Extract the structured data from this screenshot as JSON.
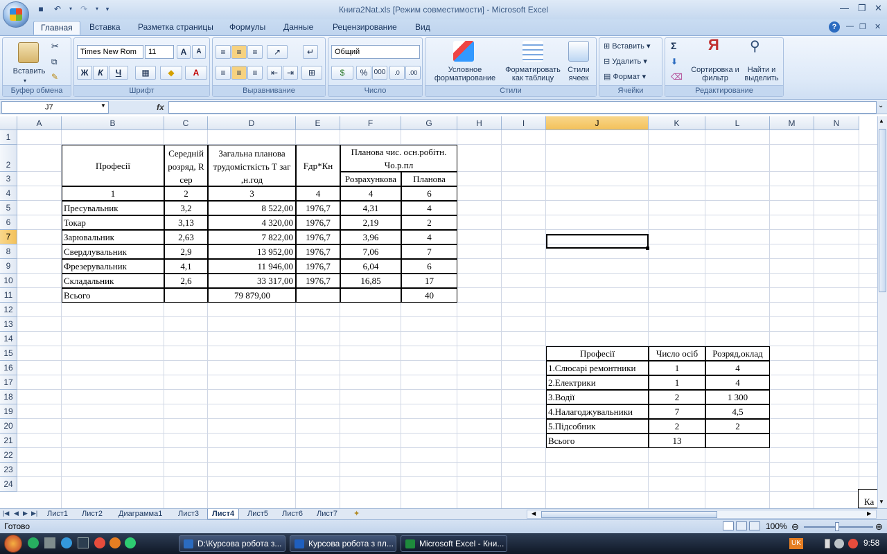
{
  "window": {
    "title": "Книга2Nat.xls  [Режим совместимости] - Microsoft Excel"
  },
  "ribbon_tabs": [
    "Главная",
    "Вставка",
    "Разметка страницы",
    "Формулы",
    "Данные",
    "Рецензирование",
    "Вид"
  ],
  "ribbon": {
    "groups": {
      "clipboard": "Буфер обмена",
      "font": "Шрифт",
      "alignment": "Выравнивание",
      "number": "Число",
      "styles": "Стили",
      "cells": "Ячейки",
      "editing": "Редактирование"
    },
    "paste": "Вставить",
    "font_name": "Times New Rom",
    "font_size": "11",
    "bold": "Ж",
    "italic": "К",
    "underline": "Ч",
    "number_format": "Общий",
    "percent": "%",
    "thousands": "000",
    "cond_format": "Условное форматирование",
    "format_table": "Форматировать как таблицу",
    "cell_styles": "Стили ячеек",
    "insert": "Вставить",
    "delete": "Удалить",
    "format": "Формат",
    "sum": "Σ",
    "sort": "Сортировка и фильтр",
    "find": "Найти и выделить"
  },
  "formula_bar": {
    "name_box": "J7",
    "fx": "fx",
    "formula": ""
  },
  "columns": [
    "A",
    "B",
    "C",
    "D",
    "E",
    "F",
    "G",
    "H",
    "I",
    "J",
    "K",
    "L",
    "M",
    "N"
  ],
  "rows": [
    "1",
    "2",
    "3",
    "4",
    "5",
    "6",
    "7",
    "8",
    "9",
    "10",
    "11",
    "12",
    "13",
    "14",
    "15",
    "16",
    "17",
    "18",
    "19",
    "20",
    "21",
    "22",
    "23",
    "24"
  ],
  "table1": {
    "h_prof": "Професії",
    "h_rank": "Середній розряд, R сер",
    "h_labor": "Загальна планова трудомісткість Т заг ,н.год",
    "h_fd": "Fдр*Кн",
    "h_plan_group": "Планова чис. осн.робітн. Чо.р.пл",
    "h_calc": "Розрахункова",
    "h_plan": "Планова",
    "nums": [
      "1",
      "2",
      "3",
      "4",
      "4",
      "6"
    ],
    "rows": [
      [
        "Пресувальник",
        "3,2",
        "8 522,00",
        "1976,7",
        "4,31",
        "4"
      ],
      [
        "Токар",
        "3,13",
        "4 320,00",
        "1976,7",
        "2,19",
        "2"
      ],
      [
        "Зарювальник",
        "2,63",
        "7 822,00",
        "1976,7",
        "3,96",
        "4"
      ],
      [
        "Свердлувальник",
        "2,9",
        "13 952,00",
        "1976,7",
        "7,06",
        "7"
      ],
      [
        "Фрезерувальник",
        "4,1",
        "11 946,00",
        "1976,7",
        "6,04",
        "6"
      ],
      [
        "Складальник",
        "2,6",
        "33 317,00",
        "1976,7",
        "16,85",
        "17"
      ]
    ],
    "total": [
      "Всього",
      "",
      "79 879,00",
      "",
      "",
      "40"
    ]
  },
  "table2": {
    "headers": [
      "Професії",
      "Число осіб",
      "Розряд,оклад"
    ],
    "rows": [
      [
        "1.Слюсарі ремонтники",
        "1",
        "4"
      ],
      [
        "2.Електрики",
        "1",
        "4"
      ],
      [
        "3.Водії",
        "2",
        "1 300"
      ],
      [
        "4.Налагоджувальники",
        "7",
        "4,5"
      ],
      [
        "5.Підсобник",
        "2",
        "2"
      ],
      [
        "Всього",
        "13",
        ""
      ]
    ]
  },
  "partial_cell": "Ка",
  "sheet_tabs": [
    "Лист1",
    "Лист2",
    "Диаграмма1",
    "Лист3",
    "Лист4",
    "Лист5",
    "Лист6",
    "Лист7"
  ],
  "active_sheet": "Лист4",
  "status": {
    "ready": "Готово",
    "zoom": "100%"
  },
  "taskbar": {
    "items": [
      "D:\\Курсова робота з...",
      "Курсова робота з пл...",
      "Microsoft Excel - Кни..."
    ],
    "lang": "UK",
    "time": "9:58"
  }
}
